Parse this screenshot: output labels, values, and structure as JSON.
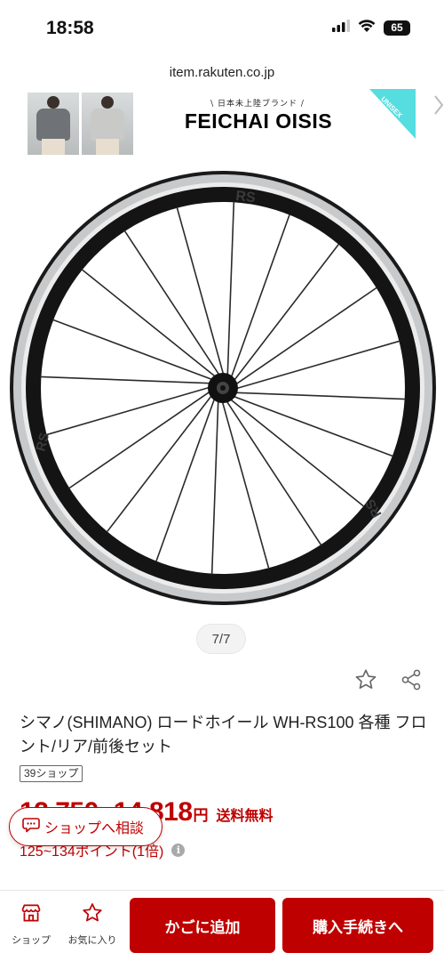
{
  "status_bar": {
    "time": "18:58",
    "battery": "65"
  },
  "browser": {
    "url": "item.rakuten.co.jp"
  },
  "ad": {
    "subtitle": "\\ 日本未上陸ブランド /",
    "brand": "FEICHAI OISIS",
    "ribbon": "UNISEX",
    "accent_color": "#55dde0"
  },
  "gallery": {
    "counter": "7/7"
  },
  "product": {
    "title": "シマノ(SHIMANO) ロードホイール WH-RS100 各種 フロント/リア/前後セット",
    "shop_tag": "39ショップ",
    "price": "12,750~14,818",
    "yen": "円",
    "shipping": "送料無料",
    "points": "125~134ポイント(1倍)",
    "info_icon": "i",
    "price_color": "#bf0000"
  },
  "consult": {
    "label": "ショップへ相談",
    "icon": "chat-icon"
  },
  "bottom_bar": {
    "shop_label": "ショップ",
    "favorite_label": "お気に入り",
    "add_to_cart": "かごに追加",
    "checkout": "購入手続きへ",
    "cta_color": "#bf0000"
  }
}
